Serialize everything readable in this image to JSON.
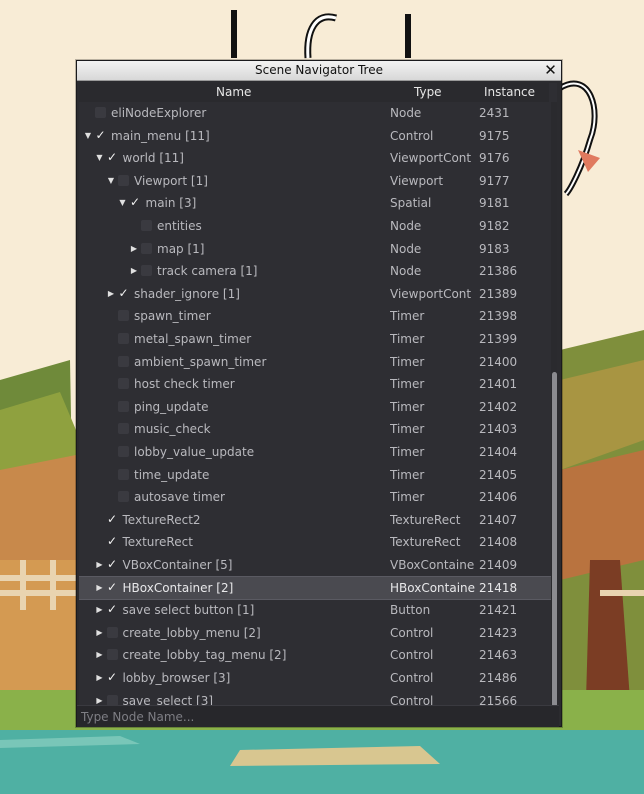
{
  "window": {
    "title": "Scene Navigator Tree",
    "close_label": "✕"
  },
  "columns": {
    "name": "Name",
    "type": "Type",
    "instance": "Instance"
  },
  "nodes": [
    {
      "name": "eliNodeExplorer",
      "type": "Node",
      "instance": "2431",
      "depth": 0,
      "arrow": "none",
      "checked": false
    },
    {
      "name": "main_menu [11]",
      "type": "Control",
      "instance": "9175",
      "depth": 0,
      "arrow": "expanded",
      "checked": true
    },
    {
      "name": "world [11]",
      "type": "ViewportCont",
      "instance": "9176",
      "depth": 1,
      "arrow": "expanded",
      "checked": true
    },
    {
      "name": "Viewport [1]",
      "type": "Viewport",
      "instance": "9177",
      "depth": 2,
      "arrow": "expanded",
      "checked": false
    },
    {
      "name": "main [3]",
      "type": "Spatial",
      "instance": "9181",
      "depth": 3,
      "arrow": "expanded",
      "checked": true
    },
    {
      "name": "entities",
      "type": "Node",
      "instance": "9182",
      "depth": 4,
      "arrow": "none",
      "checked": false
    },
    {
      "name": "map [1]",
      "type": "Node",
      "instance": "9183",
      "depth": 4,
      "arrow": "collapsed",
      "checked": false
    },
    {
      "name": "track camera [1]",
      "type": "Node",
      "instance": "21386",
      "depth": 4,
      "arrow": "collapsed",
      "checked": false
    },
    {
      "name": "shader_ignore [1]",
      "type": "ViewportCont",
      "instance": "21389",
      "depth": 2,
      "arrow": "collapsed",
      "checked": true
    },
    {
      "name": "spawn_timer",
      "type": "Timer",
      "instance": "21398",
      "depth": 2,
      "arrow": "none",
      "checked": false
    },
    {
      "name": "metal_spawn_timer",
      "type": "Timer",
      "instance": "21399",
      "depth": 2,
      "arrow": "none",
      "checked": false
    },
    {
      "name": "ambient_spawn_timer",
      "type": "Timer",
      "instance": "21400",
      "depth": 2,
      "arrow": "none",
      "checked": false
    },
    {
      "name": "host check timer",
      "type": "Timer",
      "instance": "21401",
      "depth": 2,
      "arrow": "none",
      "checked": false
    },
    {
      "name": "ping_update",
      "type": "Timer",
      "instance": "21402",
      "depth": 2,
      "arrow": "none",
      "checked": false
    },
    {
      "name": "music_check",
      "type": "Timer",
      "instance": "21403",
      "depth": 2,
      "arrow": "none",
      "checked": false
    },
    {
      "name": "lobby_value_update",
      "type": "Timer",
      "instance": "21404",
      "depth": 2,
      "arrow": "none",
      "checked": false
    },
    {
      "name": "time_update",
      "type": "Timer",
      "instance": "21405",
      "depth": 2,
      "arrow": "none",
      "checked": false
    },
    {
      "name": "autosave timer",
      "type": "Timer",
      "instance": "21406",
      "depth": 2,
      "arrow": "none",
      "checked": false
    },
    {
      "name": "TextureRect2",
      "type": "TextureRect",
      "instance": "21407",
      "depth": 1,
      "arrow": "none",
      "checked": true
    },
    {
      "name": "TextureRect",
      "type": "TextureRect",
      "instance": "21408",
      "depth": 1,
      "arrow": "none",
      "checked": true
    },
    {
      "name": "VBoxContainer [5]",
      "type": "VBoxContaine",
      "instance": "21409",
      "depth": 1,
      "arrow": "collapsed",
      "checked": true
    },
    {
      "name": "HBoxContainer [2]",
      "type": "HBoxContaine",
      "instance": "21418",
      "depth": 1,
      "arrow": "collapsed",
      "checked": true,
      "selected": true
    },
    {
      "name": "save select button [1]",
      "type": "Button",
      "instance": "21421",
      "depth": 1,
      "arrow": "collapsed",
      "checked": true
    },
    {
      "name": "create_lobby_menu [2]",
      "type": "Control",
      "instance": "21423",
      "depth": 1,
      "arrow": "collapsed",
      "checked": false
    },
    {
      "name": "create_lobby_tag_menu [2]",
      "type": "Control",
      "instance": "21463",
      "depth": 1,
      "arrow": "collapsed",
      "checked": false
    },
    {
      "name": "lobby_browser [3]",
      "type": "Control",
      "instance": "21486",
      "depth": 1,
      "arrow": "collapsed",
      "checked": true
    },
    {
      "name": "save_select [3]",
      "type": "Control",
      "instance": "21566",
      "depth": 1,
      "arrow": "collapsed",
      "checked": false
    }
  ],
  "search": {
    "placeholder": "Type Node Name...",
    "value": ""
  },
  "colors": {
    "panel": "#2e2e33",
    "text": "#b9b9be",
    "selected_row": "#4a4a50",
    "titlebar": "#e4e4e4"
  }
}
